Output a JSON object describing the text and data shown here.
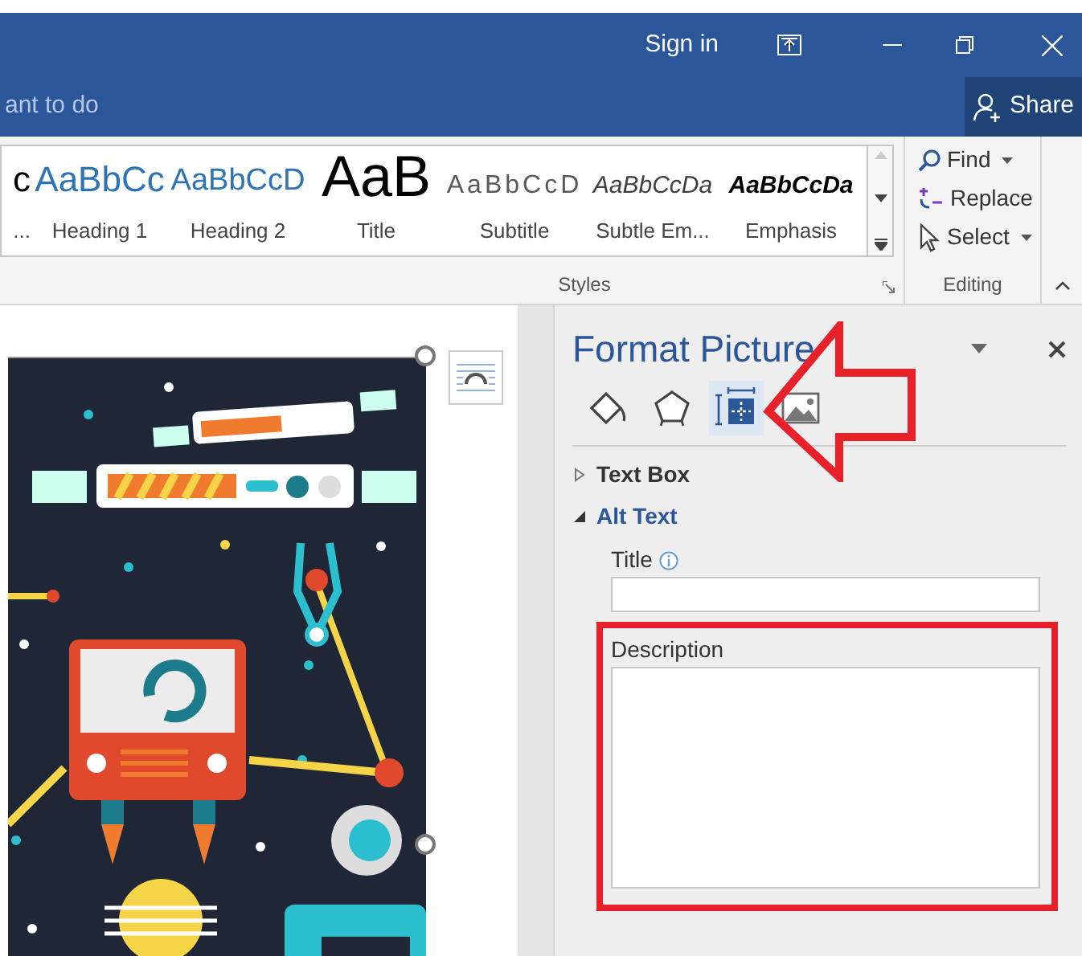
{
  "title_bar": {
    "sign_in": "Sign in"
  },
  "tell_me": {
    "placeholder": "ant to do"
  },
  "share_button": "Share",
  "styles_gallery": {
    "group_label": "Styles",
    "items": [
      {
        "kind": "normal",
        "preview": "c",
        "label": "..."
      },
      {
        "kind": "heading1",
        "preview": "AaBbCc",
        "label": "Heading 1"
      },
      {
        "kind": "heading2",
        "preview": "AaBbCcD",
        "label": "Heading 2"
      },
      {
        "kind": "title",
        "preview": "AaB",
        "label": "Title"
      },
      {
        "kind": "subtitle",
        "preview": "AaBbCcD",
        "label": "Subtitle"
      },
      {
        "kind": "subtle_emphasis",
        "preview": "AaBbCcDa",
        "label": "Subtle Em..."
      },
      {
        "kind": "emphasis",
        "preview": "AaBbCcDa",
        "label": "Emphasis"
      }
    ]
  },
  "editing": {
    "group_label": "Editing",
    "items": [
      {
        "kind": "find",
        "label": "Find",
        "has_menu": true
      },
      {
        "kind": "replace",
        "label": "Replace",
        "has_menu": false
      },
      {
        "kind": "select",
        "label": "Select",
        "has_menu": true
      }
    ]
  },
  "pane": {
    "title": "Format Picture",
    "tabs": [
      {
        "kind": "fill",
        "selected": false
      },
      {
        "kind": "shape",
        "selected": false
      },
      {
        "kind": "layout",
        "selected": true
      },
      {
        "kind": "picture",
        "selected": false
      }
    ],
    "sections": [
      {
        "label": "Text Box",
        "expanded": false
      },
      {
        "label": "Alt Text",
        "expanded": true,
        "fields": [
          {
            "kind": "line",
            "label": "Title",
            "has_info": true
          },
          {
            "kind": "area",
            "label": "Description",
            "has_info": false
          }
        ]
      }
    ]
  }
}
